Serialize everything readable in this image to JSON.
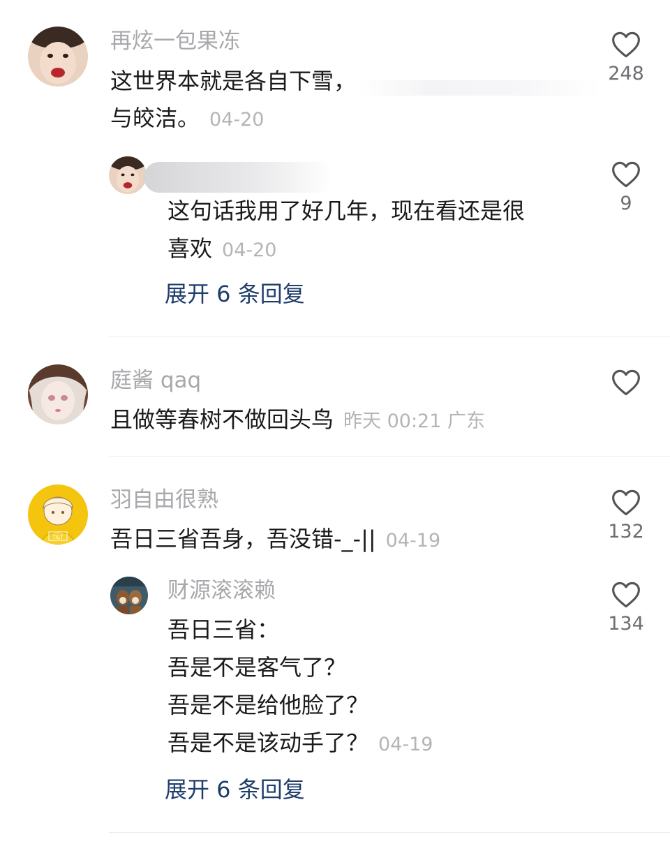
{
  "comments": [
    {
      "username": "再炫一包果冻",
      "text_line1": "这世界本就是各自下雪，",
      "text_line2": "与皎洁。",
      "date": "04-20",
      "likes": "248",
      "reply": {
        "text_line1": "这句话我用了好几年，现在看还是很",
        "text_line2": "喜欢",
        "date": "04-20",
        "likes": "9"
      },
      "expand_label": "展开 6 条回复"
    },
    {
      "username": "庭酱 qaq",
      "text": "且做等春树不做回头鸟",
      "meta": "昨天 00:21 广东"
    },
    {
      "username": "羽自由很熟",
      "text": "吾日三省吾身，吾没错-_-||",
      "date": "04-19",
      "likes": "132",
      "avatar_text": "T&T",
      "reply": {
        "username": "财源滚滚赖",
        "lines": [
          "吾日三省：",
          "吾是不是客气了？",
          "吾是不是给他脸了？",
          "吾是不是该动手了？"
        ],
        "date": "04-19",
        "likes": "134"
      },
      "expand_label": "展开 6 条回复"
    }
  ],
  "colors": {
    "username": "#a8a8ac",
    "text": "#1a1a1a",
    "meta": "#b4b4b8",
    "expand": "#1f3d6b",
    "heart": "#555555"
  },
  "icons": {
    "like": "heart-outline-icon"
  }
}
